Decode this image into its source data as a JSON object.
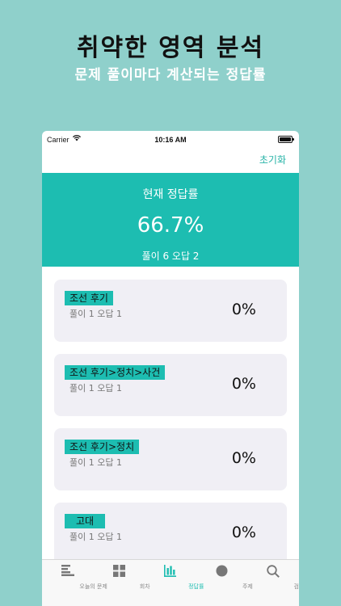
{
  "promo": {
    "title": "취약한 영역 분석",
    "subtitle": "문제 풀이마다 계산되는 정답률"
  },
  "status_bar": {
    "carrier": "Carrier",
    "time": "10:16 AM"
  },
  "nav": {
    "reset_label": "초기화"
  },
  "summary": {
    "label": "현재 정답률",
    "rate": "66.7%",
    "counts": "풀이 6 오답 2"
  },
  "cards": [
    {
      "tag": "조선 후기",
      "counts": "풀이 1 오답 1",
      "percent": "0%"
    },
    {
      "tag": "조선 후기>정치>사건",
      "counts": "풀이 1 오답 1",
      "percent": "0%"
    },
    {
      "tag": "조선 후기>정치",
      "counts": "풀이 1 오답 1",
      "percent": "0%"
    },
    {
      "tag": "고대",
      "counts": "풀이 1 오답 1",
      "percent": "0%"
    }
  ],
  "tabs": [
    {
      "label": "오늘의 문제",
      "icon": "list-icon"
    },
    {
      "label": "회차",
      "icon": "grid-icon"
    },
    {
      "label": "정답률",
      "icon": "bar-chart-icon"
    },
    {
      "label": "주제",
      "icon": "circle-icon"
    },
    {
      "label": "검색",
      "icon": "search-icon"
    }
  ],
  "colors": {
    "background": "#8fd0cb",
    "accent": "#1dbdb1",
    "card": "#f0eff5"
  }
}
